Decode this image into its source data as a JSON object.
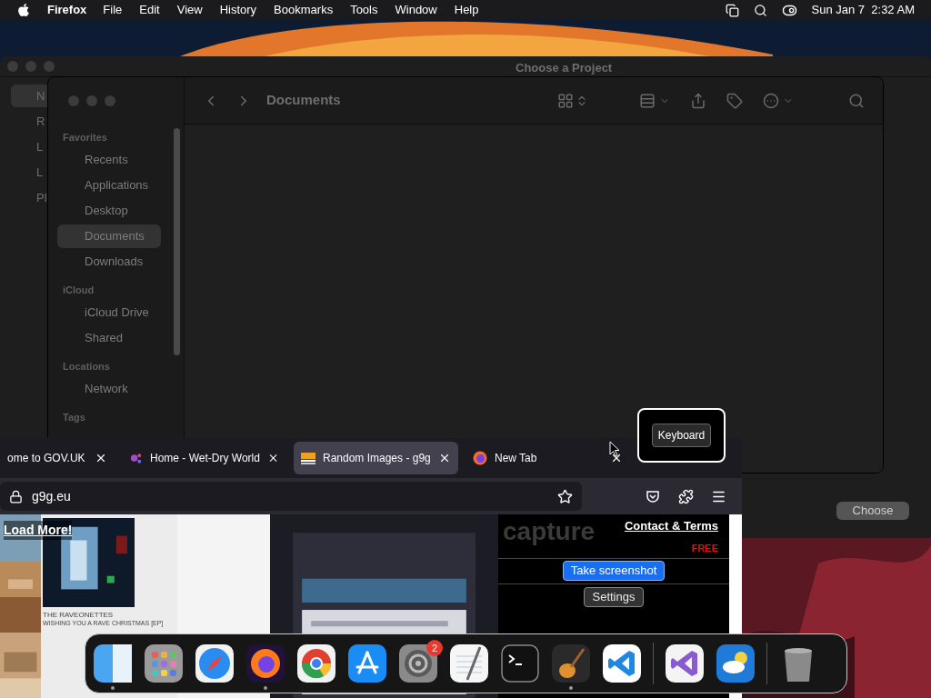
{
  "menu_bar": {
    "app": "Firefox",
    "menus": [
      "File",
      "Edit",
      "View",
      "History",
      "Bookmarks",
      "Tools",
      "Window",
      "Help"
    ],
    "clock": "Sun Jan 7  2:32 AM"
  },
  "project_window": {
    "title": "Choose a Project",
    "sidebar_items": [
      {
        "label": "N",
        "selected": true
      },
      {
        "label": "R",
        "selected": false
      },
      {
        "label": "L",
        "selected": false
      },
      {
        "label": "L",
        "selected": false
      },
      {
        "label": "Pl",
        "selected": false
      }
    ],
    "choose_button": "Choose"
  },
  "finder": {
    "location": "Documents",
    "sections": [
      {
        "title": "Favorites",
        "items": [
          {
            "label": "Recents",
            "selected": false
          },
          {
            "label": "Applications",
            "selected": false
          },
          {
            "label": "Desktop",
            "selected": false
          },
          {
            "label": "Documents",
            "selected": true
          },
          {
            "label": "Downloads",
            "selected": false
          }
        ]
      },
      {
        "title": "iCloud",
        "items": [
          {
            "label": "iCloud Drive",
            "selected": false
          },
          {
            "label": "Shared",
            "selected": false
          }
        ]
      },
      {
        "title": "Locations",
        "items": [
          {
            "label": "Network",
            "selected": false
          }
        ]
      },
      {
        "title": "Tags"
      }
    ]
  },
  "keyboard_popup": {
    "label": "Keyboard"
  },
  "browser": {
    "tabs": [
      {
        "title": "ome to GOV.UK",
        "kind": "none",
        "selected": false
      },
      {
        "title": "Home - Wet-Dry World",
        "kind": "dots",
        "selected": false
      },
      {
        "title": "Random Images - g9g",
        "kind": "stripes",
        "selected": true
      },
      {
        "title": "New Tab",
        "kind": "globe",
        "selected": false
      }
    ],
    "url": "g9g.eu",
    "page": {
      "load_more": "Load More!",
      "album_title": "THE RAVEONETTES",
      "album_subtitle": "WISHING YOU A RAVE CHRISTMAS [EP]",
      "headline": "capture",
      "badge": "FREE",
      "contact": "Contact & Terms",
      "primary_button": "Take screenshot",
      "secondary_button": "Settings"
    }
  },
  "dock": {
    "apps": [
      {
        "kind": "finder",
        "running": true
      },
      {
        "kind": "launchpad",
        "running": false
      },
      {
        "kind": "safari",
        "running": false
      },
      {
        "kind": "firefox",
        "running": true
      },
      {
        "kind": "chrome",
        "running": false
      },
      {
        "kind": "appstore",
        "running": false
      },
      {
        "kind": "settings",
        "running": false,
        "badge": "2"
      },
      {
        "kind": "textedit",
        "running": false
      },
      {
        "kind": "terminal",
        "running": false
      },
      {
        "kind": "guitar",
        "running": true
      },
      {
        "kind": "vscode",
        "running": false
      },
      {
        "kind": "separator"
      },
      {
        "kind": "visualstudio",
        "running": false
      },
      {
        "kind": "weather",
        "running": false
      },
      {
        "kind": "separator"
      },
      {
        "kind": "trash",
        "running": false
      }
    ]
  }
}
